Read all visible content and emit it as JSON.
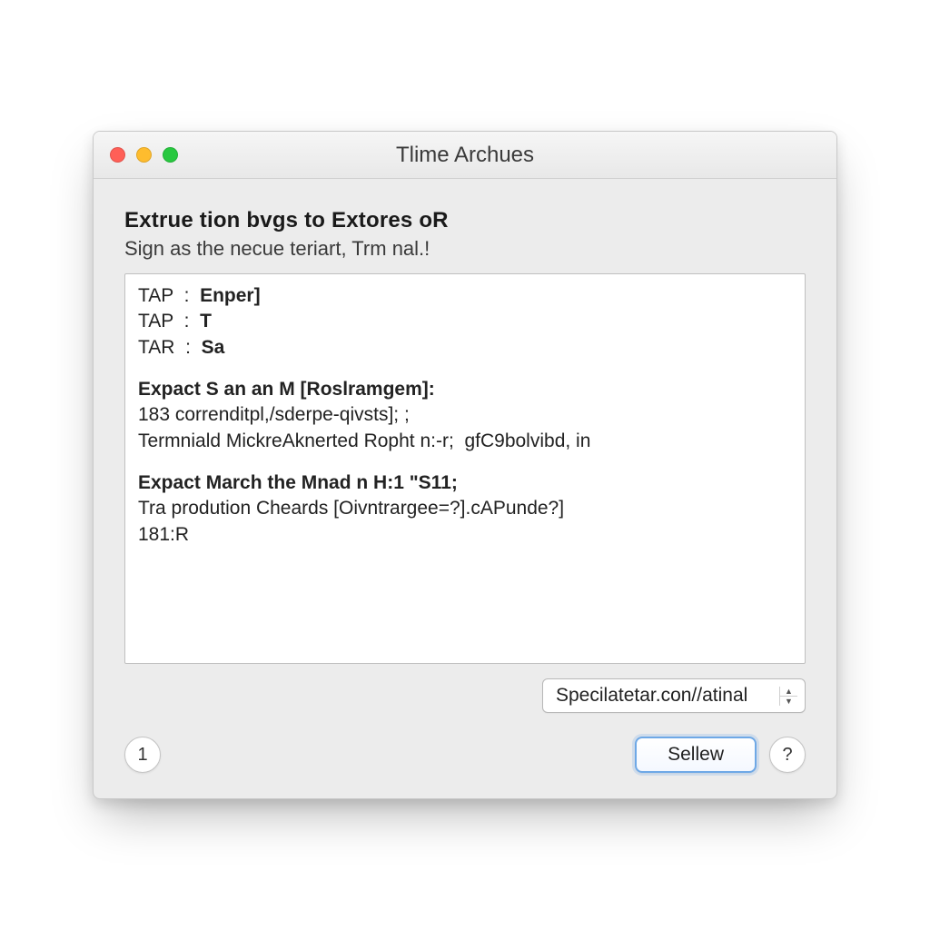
{
  "window": {
    "title": "Tlime Archues"
  },
  "header": {
    "heading": "Extrue tion bvgs to Extores oR",
    "subheading": "Sign as the necue teriart, Trm nal.!"
  },
  "textbox": {
    "lines": [
      {
        "pre": "TAP  :  ",
        "bold": "Enper]"
      },
      {
        "pre": "TAP  :  ",
        "bold": "T"
      },
      {
        "pre": "TAR  :  ",
        "bold": "Sa"
      }
    ],
    "blocks": [
      {
        "title": "Expact S an an M [Roslramgem]:",
        "l1": "183 correnditpl,/sderpe-qivsts]; ;",
        "l2": "Termniald MickreAknerted Ropht n:-r;  gfC9bolvibd, in"
      },
      {
        "title": "Expact March the Mnad n H:1 \"S11;",
        "l1": "Tra prodution Cheards [Oivntrargee=?].cAPunde?]",
        "l2": "181:R"
      }
    ]
  },
  "select": {
    "value": "Specilatetar.con//atinal"
  },
  "footer": {
    "page_indicator": "1",
    "primary_label": "Sellew",
    "help_label": "?"
  }
}
